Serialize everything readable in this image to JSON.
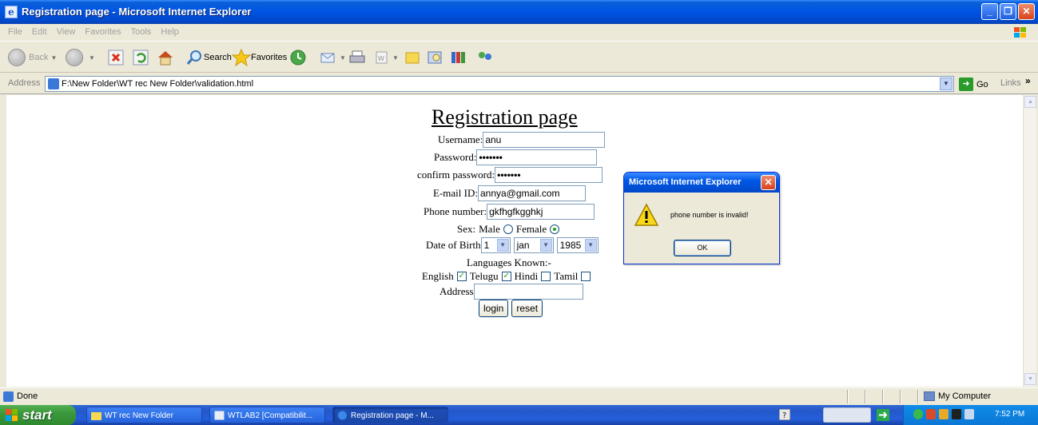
{
  "window": {
    "title": "Registration page - Microsoft Internet Explorer",
    "min_glyph": "_",
    "max_glyph": "❐",
    "close_glyph": "✕"
  },
  "menu": [
    "File",
    "Edit",
    "View",
    "Favorites",
    "Tools",
    "Help"
  ],
  "toolbar": {
    "back_label": "Back",
    "search_label": "Search",
    "favorites_label": "Favorites"
  },
  "addressbar": {
    "label": "Address",
    "url": "F:\\New Folder\\WT rec New Folder\\validation.html",
    "go_label": "Go",
    "links_label": "Links",
    "links_chevron": "»"
  },
  "form": {
    "title": "Registration page",
    "username_label": "Username:",
    "username_value": "anu",
    "password_label": "Password:",
    "password_value": "•••••••",
    "confirm_label": "confirm password:",
    "confirm_value": "•••••••",
    "email_label": "E-mail ID:",
    "email_value": "annya@gmail.com",
    "phone_label": "Phone number:",
    "phone_value": "gkfhgfkgghkj",
    "sex_label": "Sex:",
    "male_label": "Male",
    "female_label": "Female",
    "sex_selected": "Female",
    "dob_label": "Date of Birth",
    "dob_day": "1",
    "dob_month": "jan",
    "dob_year": "1985",
    "languages_label": "Languages Known:-",
    "languages": [
      {
        "name": "English",
        "checked": true
      },
      {
        "name": "Telugu",
        "checked": true
      },
      {
        "name": "Hindi",
        "checked": false
      },
      {
        "name": "Tamil",
        "checked": false
      }
    ],
    "address_label": "Address",
    "address_value": "",
    "login_label": "login",
    "reset_label": "reset"
  },
  "dialog": {
    "title": "Microsoft Internet Explorer",
    "message": "phone number is invalid!",
    "ok_label": "OK"
  },
  "statusbar": {
    "text": "Done",
    "zone": "My Computer"
  },
  "taskbar": {
    "start_label": "start",
    "tasks": [
      {
        "label": "WT rec New Folder"
      },
      {
        "label": "WTLAB2 [Compatibilit..."
      },
      {
        "label": "Registration page - M..."
      }
    ],
    "clock": "7:52 PM"
  },
  "colors": {
    "xp_blue": "#0054e3",
    "start_green": "#3c983c",
    "check_green": "#21a121"
  }
}
